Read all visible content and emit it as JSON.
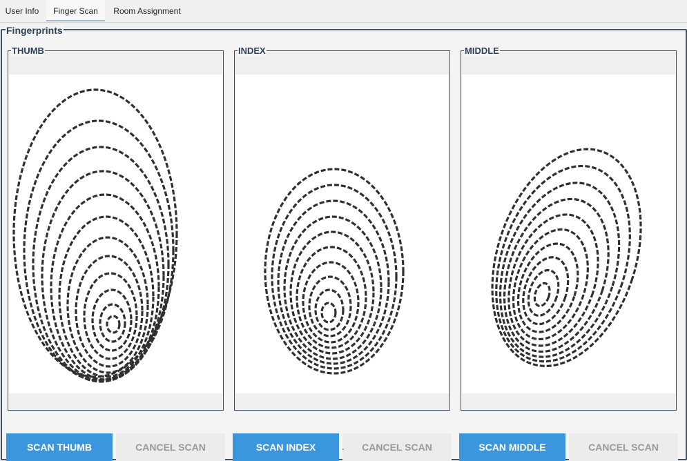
{
  "tabs": [
    {
      "label": "User Info",
      "active": false
    },
    {
      "label": "Finger Scan",
      "active": true
    },
    {
      "label": "Room Assignment",
      "active": false
    }
  ],
  "fingerprints_group": {
    "title": "Fingerprints",
    "fingers": [
      {
        "label": "THUMB",
        "scan_button": "SCAN THUMB",
        "cancel_button": "CANCEL SCAN"
      },
      {
        "label": "INDEX",
        "scan_button": "SCAN INDEX",
        "cancel_button": "CANCEL SCAN"
      },
      {
        "label": "MIDDLE",
        "scan_button": "SCAN MIDDLE",
        "cancel_button": "CANCEL SCAN"
      }
    ]
  },
  "colors": {
    "accent": "#3a97dd",
    "frame_border": "#3f4f60",
    "title_text": "#2e4057",
    "disabled_text": "#9a9a9a"
  }
}
